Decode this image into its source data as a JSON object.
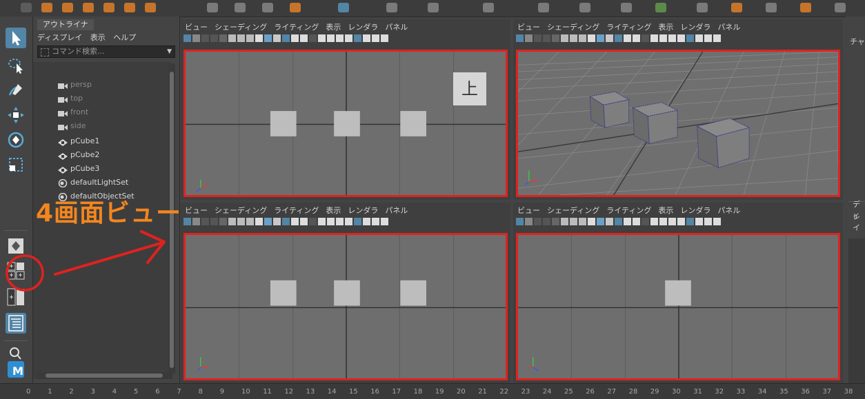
{
  "outliner": {
    "tab": "アウトライナ",
    "menu": [
      "ディスプレイ",
      "表示",
      "ヘルプ"
    ],
    "search_placeholder": "コマンド検索...",
    "items": [
      {
        "label": "persp",
        "icon": "camera-icon",
        "dim": true
      },
      {
        "label": "top",
        "icon": "camera-icon",
        "dim": true
      },
      {
        "label": "front",
        "icon": "camera-icon",
        "dim": true
      },
      {
        "label": "side",
        "icon": "camera-icon",
        "dim": true
      },
      {
        "label": "pCube1",
        "icon": "mesh-icon",
        "dim": false
      },
      {
        "label": "pCube2",
        "icon": "mesh-icon",
        "dim": false
      },
      {
        "label": "pCube3",
        "icon": "mesh-icon",
        "dim": false
      },
      {
        "label": "defaultLightSet",
        "icon": "set-icon",
        "dim": false
      },
      {
        "label": "defaultObjectSet",
        "icon": "set-icon",
        "dim": false
      }
    ]
  },
  "panel_menu": [
    "ビュー",
    "シェーディング",
    "ライティング",
    "表示",
    "レンダラ",
    "パネル"
  ],
  "views": {
    "top_badge": "上"
  },
  "right_panel": {
    "label_top": "チャ",
    "label_mid1": "ディ",
    "label_mid2": "レイ"
  },
  "annotation": {
    "text": "4画面ビュー"
  },
  "timeline": {
    "ticks": [
      "0",
      "1",
      "2",
      "3",
      "4",
      "5",
      "6",
      "7",
      "8",
      "9",
      "10",
      "11",
      "12",
      "13",
      "14",
      "15",
      "16",
      "17",
      "18",
      "19",
      "20",
      "21",
      "22",
      "23",
      "24",
      "25",
      "26",
      "27",
      "28",
      "29",
      "30",
      "31",
      "32",
      "33",
      "34",
      "35",
      "36",
      "37",
      "38"
    ]
  },
  "colors": {
    "highlight_red": "#e0221f",
    "annotation_orange": "#f4861e",
    "accent_blue": "#5285a6"
  }
}
